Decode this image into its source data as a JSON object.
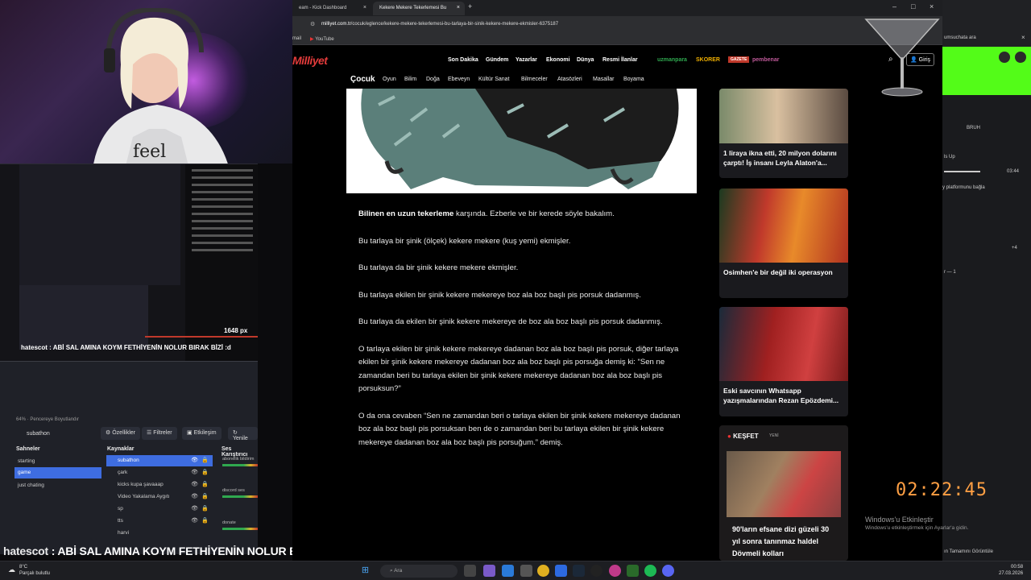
{
  "stream": {
    "chat_user": "hatescot",
    "chat_message": ": ABİ SAL AMINA KOYM FETHİYENİN NOLUR BIRAK BİZİ :d",
    "preview_px_label": "1648 px",
    "preview_chat": "hatescot : ABİ SAL AMINA KOYM FETHİYENİN NOLUR BIRAK BİZİ :d",
    "timer": "02:22:45"
  },
  "obs": {
    "status": "64%  ·  Pencereye Boyutlandır",
    "source_name": "subathon",
    "buttons": {
      "properties": "Özellikler",
      "filters": "Filtreler",
      "interact": "Etkileşim",
      "refresh": "Yenile"
    },
    "columns": {
      "scenes": "Sahneler",
      "sources": "Kaynaklar",
      "mixer": "Ses Karıştırıcı"
    },
    "scenes": [
      "starting",
      "game",
      "just chating"
    ],
    "sources": [
      "subathon",
      "çark",
      "kicks  kupa şavaaap",
      "Video Yakalama Aygıtı",
      "sp",
      "tts",
      "harvi"
    ],
    "mixer": [
      "abonelik bildirim",
      "discord ses",
      "donate"
    ]
  },
  "browser": {
    "tabs": [
      {
        "title": "eam - Kick Dashboard"
      },
      {
        "title": "Kekere Mekere Tekerlemesi Bu"
      }
    ],
    "url_domain": "milliyet.com.tr",
    "url_path": "/cocuk/eglence/kekere-mekere-tekerlemesi-bu-tarlaya-bir-sinik-kekere-mekere-ekmisler-6375187",
    "bookmarks": [
      "mail",
      "YouTube"
    ],
    "site": {
      "logo": "Milliyet",
      "nav": [
        "Son Dakika",
        "Gündem",
        "Yazarlar",
        "Ekonomi",
        "Dünya",
        "Resmi İlanlar"
      ],
      "brands": [
        "uzmanpara",
        "SKORER",
        "GAZETE",
        "pembenar"
      ],
      "login": "Giriş",
      "section": "Çocuk",
      "categories": [
        "Oyun",
        "Bilim",
        "Doğa",
        "Ebeveyn",
        "Kültür Sanat",
        "Bilmeceler",
        "Atasözleri",
        "Masallar",
        "Boyama"
      ]
    },
    "article": {
      "p1_bold": "Bilinen en uzun tekerleme",
      "p1_rest": " karşında. Ezberle ve bir kerede söyle bakalım.",
      "p2": "Bu tarlaya bir şinik (ölçek) kekere mekere (kuş yemi) ekmişler.",
      "p3": "Bu tarlaya da bir şinik kekere mekere ekmişler.",
      "p4": "Bu tarlaya ekilen bir şinik kekere mekereye boz ala boz başlı pis porsuk dadanmış.",
      "p5": "Bu tarlaya da ekilen bir şinik kekere mekereye de boz ala boz başlı pis porsuk dadanmış.",
      "p6": "O tarlaya ekilen bir şinik kekere mekereye dadanan boz ala boz başlı pis porsuk, diğer tarlaya ekilen bir şinik kekere mekereye dadanan boz ala boz başlı pis porsuğa demiş ki: “Sen ne zamandan beri bu tarlaya ekilen bir şinik kekere mekereye dadanan boz ala boz başlı pis porsuksun?”",
      "p7": "O da ona cevaben “Sen ne zamandan beri o tarlaya ekilen bir şinik kekere mekereye dadanan boz ala boz başlı pis porsuksan ben de o zamandan beri bu tarlaya ekilen bir şinik kekere mekereye dadanan boz ala boz başlı pis porsuğum.” demiş."
    },
    "cards": [
      {
        "caption": "1 liraya ikna etti, 20 milyon dolarını çarptı! İş insanı Leyla Alaton'a..."
      },
      {
        "caption": "Osimhen'e bir değil iki operasyon"
      },
      {
        "caption": "Eski savcının Whatsapp yazışmalarından Rezan Epözdemi..."
      }
    ],
    "kesfet": {
      "title": "KEŞFET",
      "badge": "YENİ",
      "caption": "90'ların efsane dizi güzeli 30 yıl sonra tanınmaz haldel Dövmeli kolları"
    }
  },
  "dashboard": {
    "search": "umsuchata ara",
    "bruh": "BRUH",
    "up": "ls Up",
    "time": "03:44",
    "platform": "y platformunu bağla",
    "plus": "+4",
    "item": "r — 1",
    "bottom": "ın Tamamını Görüntüle"
  },
  "windows": {
    "activate_title": "Windows'u Etkinleştir",
    "activate_sub": "Windows'u etkinleştirmek için Ayarlar'a gidin."
  },
  "taskbar": {
    "temp": "8°C",
    "weather": "Parçalı bulutlu",
    "search": "Ara",
    "time": "00:58",
    "date": "27.03.2026"
  },
  "colors": {
    "accent": "#3e6de0",
    "kick_green": "#53fc18",
    "timer": "#ff9f43",
    "logo_red": "#e23b3b"
  }
}
